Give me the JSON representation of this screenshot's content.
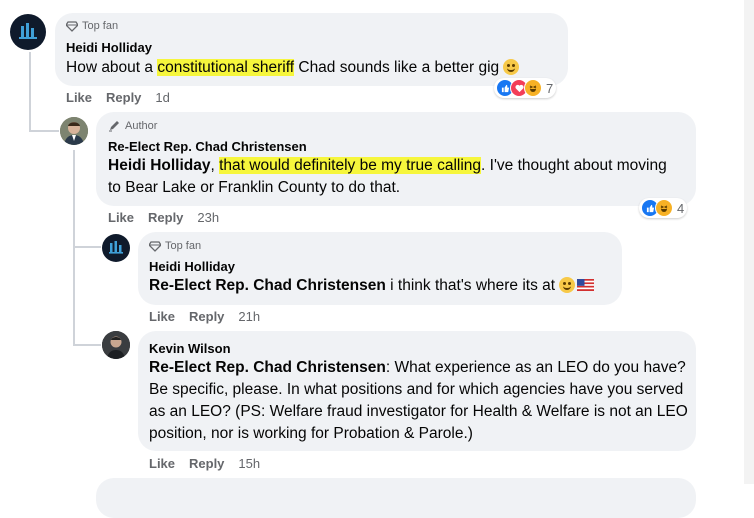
{
  "comments": [
    {
      "badge": "Top fan",
      "author": "Heidi Holliday",
      "pre": "How about a ",
      "highlight": "constitutional sheriff",
      "post": " Chad sounds like a better gig",
      "actions": {
        "like": "Like",
        "reply": "Reply",
        "time": "1d"
      },
      "reaction_count": "7"
    },
    {
      "badge": "Author",
      "author": "Re-Elect Rep. Chad Christensen",
      "mention": "Heidi Holliday",
      "pre": ", ",
      "highlight": "that would definitely be my true calling",
      "post": ". I've thought about moving to Bear Lake or Franklin County to do that.",
      "actions": {
        "like": "Like",
        "reply": "Reply",
        "time": "23h"
      },
      "reaction_count": "4"
    },
    {
      "badge": "Top fan",
      "author": "Heidi Holliday",
      "mention": "Re-Elect Rep. Chad Christensen",
      "post": " i think that's where its at",
      "actions": {
        "like": "Like",
        "reply": "Reply",
        "time": "21h"
      }
    },
    {
      "author": "Kevin Wilson",
      "mention": "Re-Elect Rep. Chad Christensen",
      "post": ": What experience as an LEO do you have? Be specific, please. In what positions and for which agencies have you served as an LEO? (PS: Welfare fraud investigator for Health & Welfare is not an LEO position, nor is working for Probation & Parole.)",
      "actions": {
        "like": "Like",
        "reply": "Reply",
        "time": "15h"
      }
    }
  ],
  "icons": {
    "top_fan": "diamond-icon",
    "author": "pencil-icon",
    "reactions": [
      "like-reaction-icon",
      "love-reaction-icon",
      "haha-reaction-icon"
    ]
  },
  "colors": {
    "bubble": "#f0f2f5",
    "highlight": "#f6f63c",
    "like_blue": "#1877f2",
    "love_red": "#f33e58",
    "haha_yellow": "#f7b125"
  }
}
